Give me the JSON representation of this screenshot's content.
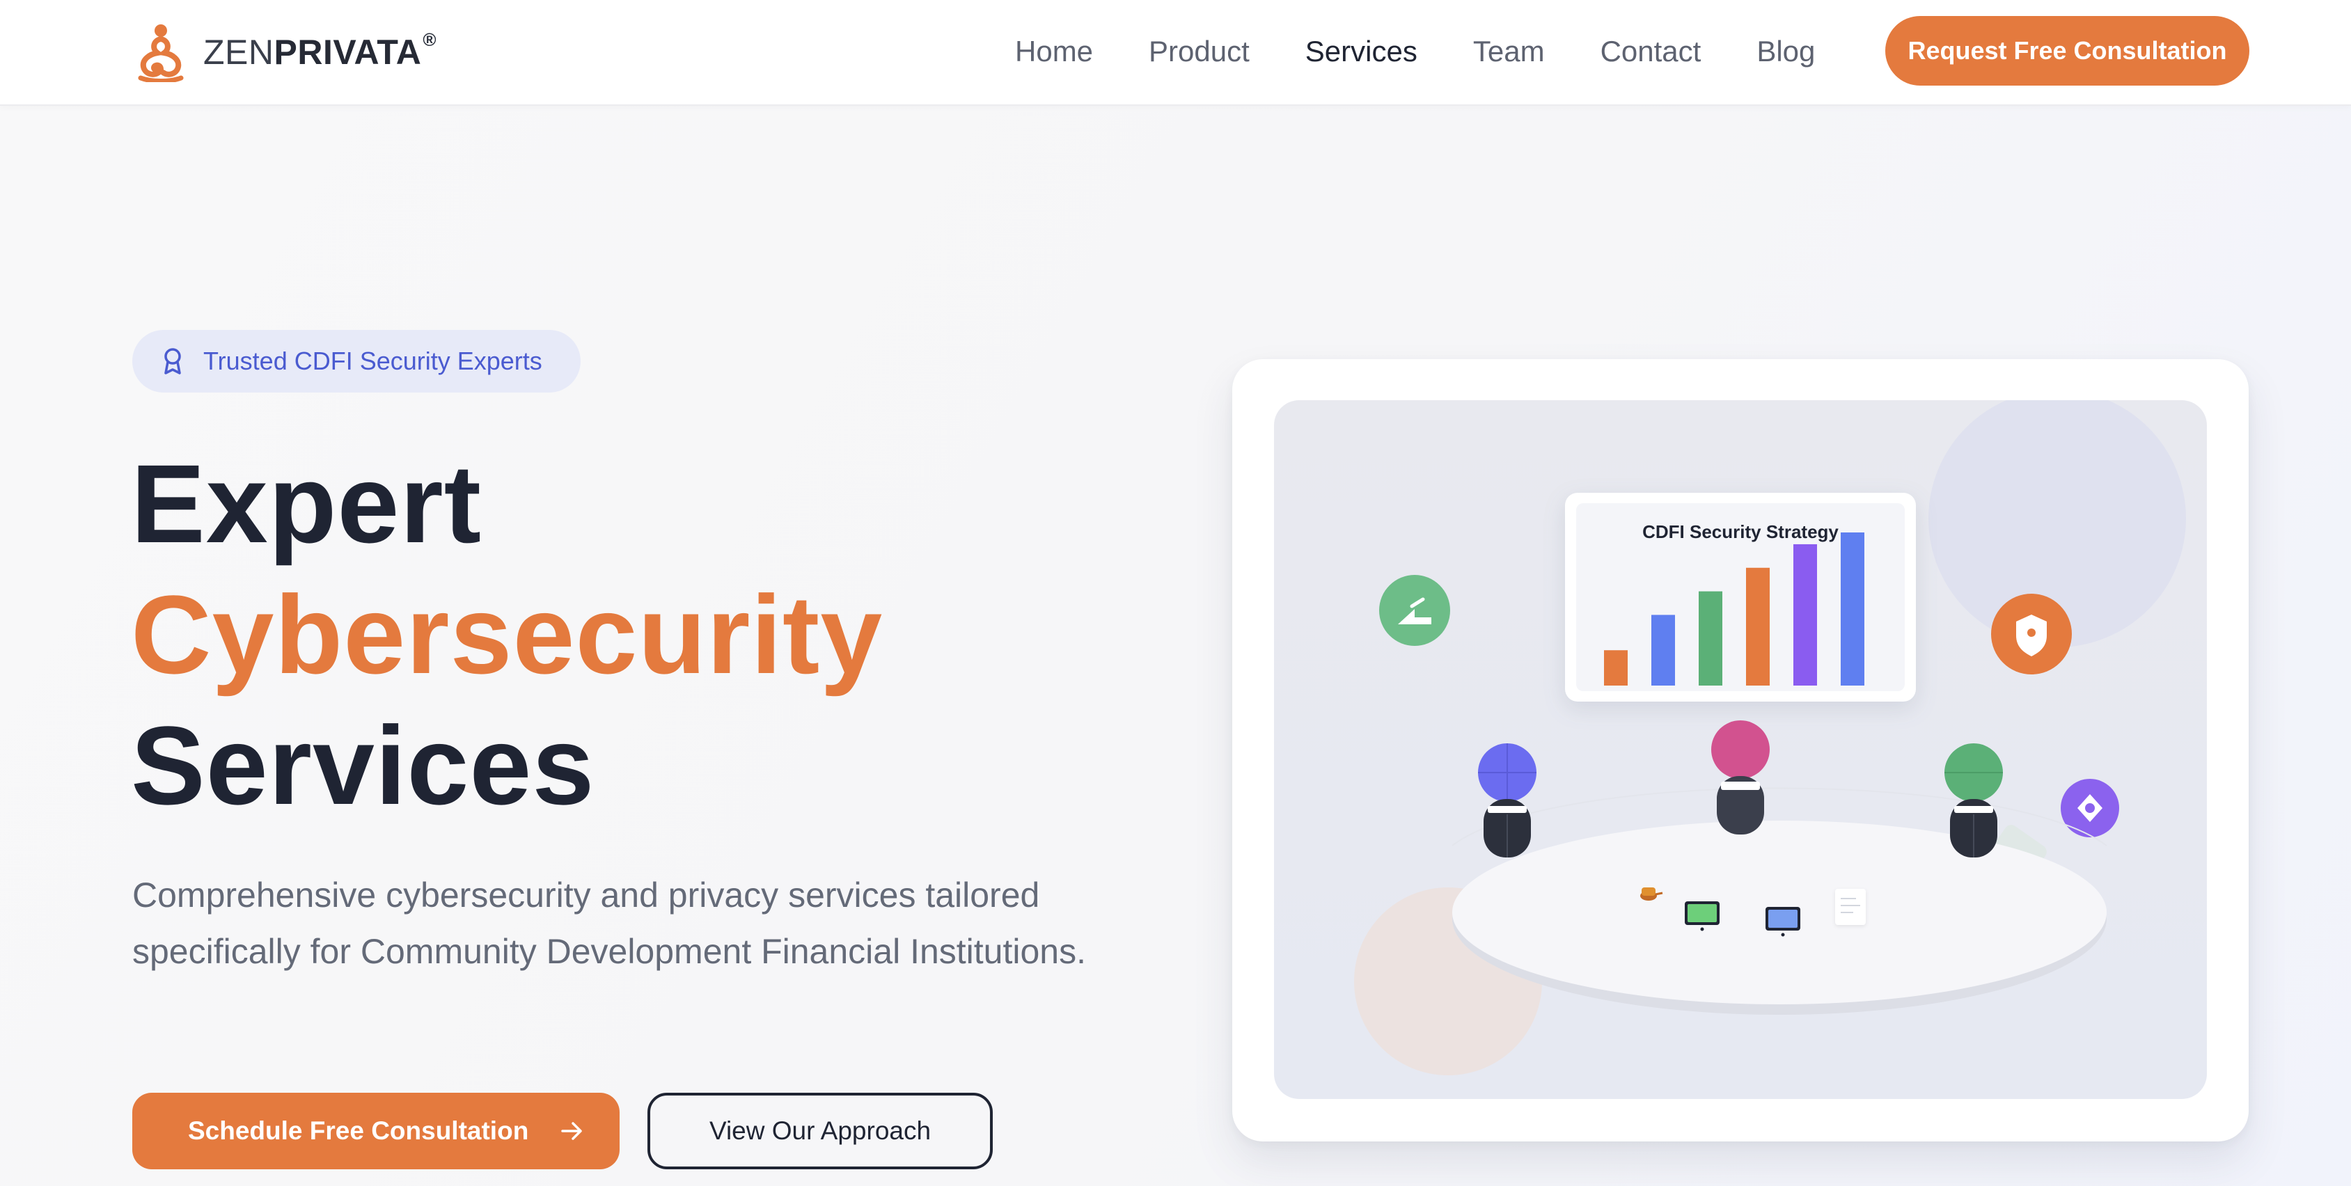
{
  "brand": {
    "name_light": "ZEN",
    "name_bold": "PRIVATA",
    "registered": "®",
    "icon": "meditating-figure-logo-icon",
    "accent_color": "#e47a3e"
  },
  "nav": {
    "items": [
      {
        "label": "Home",
        "active": false
      },
      {
        "label": "Product",
        "active": false
      },
      {
        "label": "Services",
        "active": true
      },
      {
        "label": "Team",
        "active": false
      },
      {
        "label": "Contact",
        "active": false
      },
      {
        "label": "Blog",
        "active": false
      }
    ],
    "cta_label": "Request Free Consultation"
  },
  "hero": {
    "badge": {
      "icon": "award-ribbon-icon",
      "label": "Trusted CDFI Security Experts"
    },
    "headline": {
      "line1": "Expert",
      "line2": "Cybersecurity",
      "line3": "Services"
    },
    "subtitle": "Comprehensive cybersecurity and privacy services tailored specifically for Community Development Financial Institutions.",
    "primary_button": {
      "label": "Schedule Free Consultation",
      "icon": "arrow-right-icon"
    },
    "secondary_button": {
      "label": "View Our Approach"
    }
  },
  "illustration": {
    "board_title": "CDFI Security Strategy",
    "bar_chart": {
      "type": "bar",
      "values": [
        3,
        6,
        8,
        10,
        12,
        13
      ],
      "colors": [
        "#e47a3e",
        "#5f7ff0",
        "#5bb077",
        "#e47a3e",
        "#8a5cf0",
        "#5f7ff0"
      ]
    },
    "floating_icons": [
      "chart-up-icon",
      "shield-icon",
      "location-pin-icon"
    ],
    "people_colors": [
      "#6b6cf0",
      "#d2528f",
      "#5bb077"
    ],
    "table_items": [
      "coffee-cup-icon",
      "laptop-icon",
      "laptop-icon",
      "document-icon"
    ]
  },
  "colors": {
    "headline_dark": "#1f2433",
    "accent_orange": "#e47a3e",
    "badge_bg": "#e7eaf8",
    "badge_text": "#4a5bd0"
  }
}
